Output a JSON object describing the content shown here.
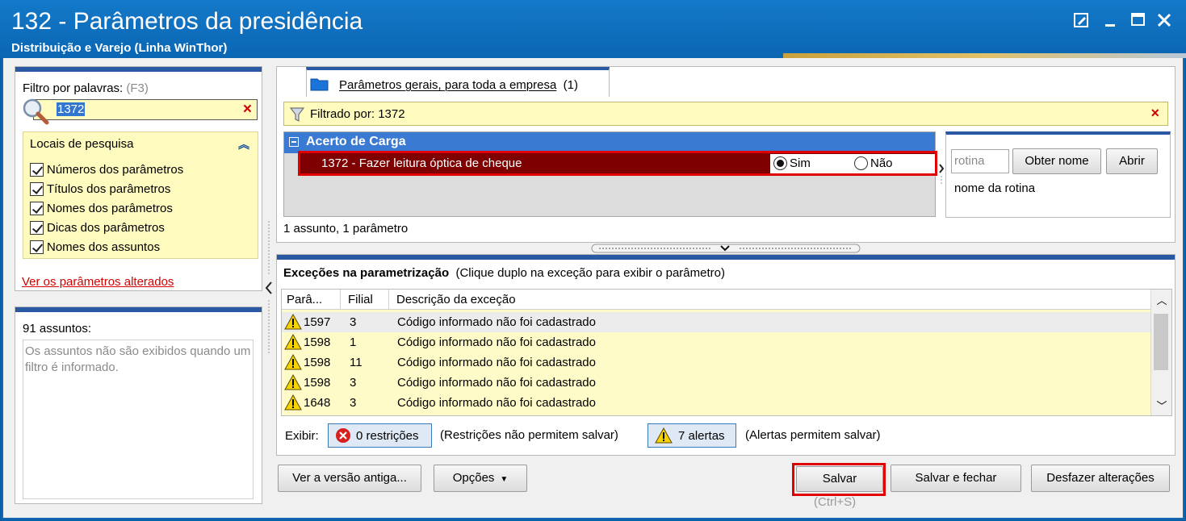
{
  "window": {
    "title": "132 - Parâmetros da presidência",
    "subtitle": "Distribuição e Varejo (Linha WinThor)"
  },
  "filter": {
    "label": "Filtro por palavras:",
    "shortcut": "(F3)",
    "search_value": "1372",
    "clear_symbol": "×"
  },
  "search_locations": {
    "title": "Locais de pesquisa",
    "options": [
      {
        "label": "Números dos parâmetros",
        "checked": true
      },
      {
        "label": "Títulos dos parâmetros",
        "checked": true
      },
      {
        "label": "Nomes dos parâmetros",
        "checked": true
      },
      {
        "label": "Dicas dos parâmetros",
        "checked": true
      },
      {
        "label": "Nomes dos assuntos",
        "checked": true
      }
    ]
  },
  "altered_link": "Ver os parâmetros alterados",
  "subjects": {
    "count_label": "91 assuntos:",
    "note": "Os assuntos não são exibidos quando um filtro é informado."
  },
  "tab": {
    "label": "Parâmetros gerais, para toda a empresa",
    "count": "(1)"
  },
  "filtered_by": "Filtrado por: 1372",
  "group": {
    "title": "Acerto de Carga",
    "param": {
      "label": "1372 - Fazer leitura óptica de cheque",
      "options": [
        "Sim",
        "Não"
      ],
      "selected": "Sim"
    }
  },
  "rotina": {
    "placeholder": "rotina",
    "get_name_label": "Obter nome",
    "open_label": "Abrir",
    "name_label": "nome da rotina"
  },
  "summary": "1 assunto, 1 parâmetro",
  "exceptions": {
    "title": "Exceções na parametrização",
    "hint": "(Clique duplo na exceção para exibir o parâmetro)",
    "columns": [
      "Parâ...",
      "Filial",
      "Descrição da exceção"
    ],
    "rows": [
      {
        "param": "1597",
        "filial": "3",
        "desc": "Código informado não foi cadastrado"
      },
      {
        "param": "1598",
        "filial": "1",
        "desc": "Código informado não foi cadastrado"
      },
      {
        "param": "1598",
        "filial": "11",
        "desc": "Código informado não foi cadastrado"
      },
      {
        "param": "1598",
        "filial": "3",
        "desc": "Código informado não foi cadastrado"
      },
      {
        "param": "1648",
        "filial": "3",
        "desc": "Código informado não foi cadastrado"
      }
    ],
    "show_label": "Exibir:",
    "restrictions_label": "0 restrições",
    "restrictions_note": "(Restrições não permitem salvar)",
    "alerts_label": "7 alertas",
    "alerts_note": "(Alertas permitem salvar)"
  },
  "footer": {
    "old_version_label": "Ver a versão antiga...",
    "options_label": "Opções",
    "save_label": "Salvar",
    "save_hint": "(Ctrl+S)",
    "save_close_label": "Salvar e fechar",
    "undo_label": "Desfazer alterações"
  },
  "colors": {
    "title_bar": "#0a66b3",
    "highlight_row": "#7f0000",
    "group_header": "#3a7ad2",
    "annotation_frame": "#e00000"
  }
}
